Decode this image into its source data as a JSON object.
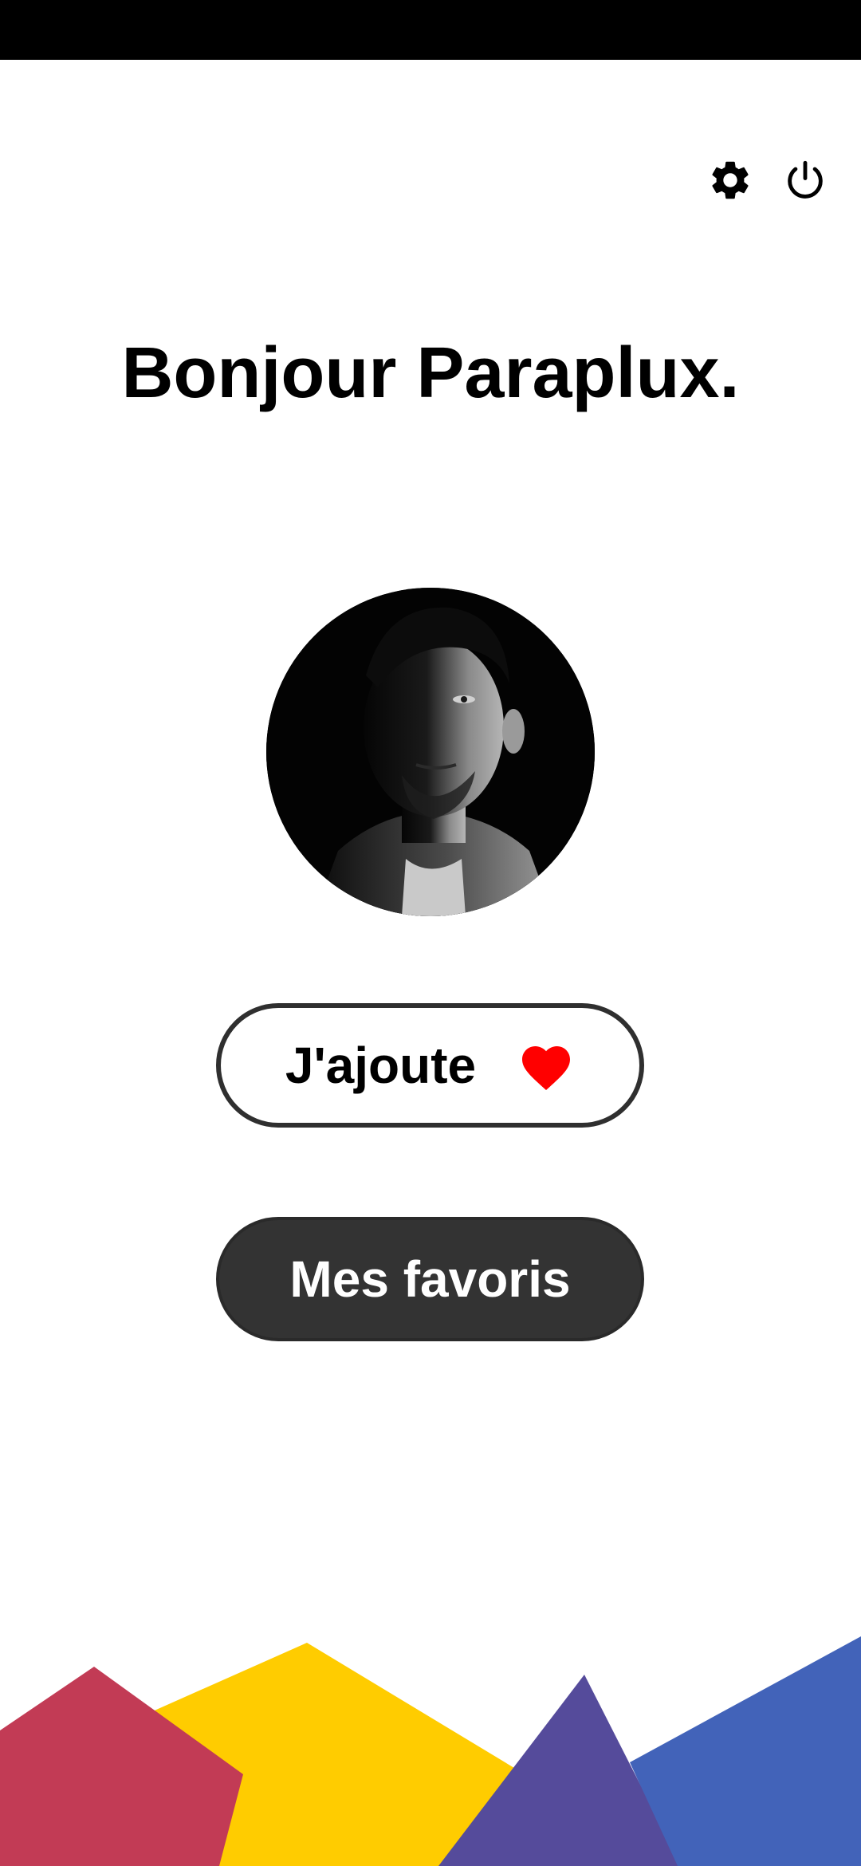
{
  "header": {
    "settings_icon": "gear-icon",
    "power_icon": "power-icon"
  },
  "greeting": {
    "text": "Bonjour Paraplux."
  },
  "profile": {
    "avatar_icon": "avatar"
  },
  "actions": {
    "add_label": "J'ajoute",
    "add_icon": "heart-icon",
    "favorites_label": "Mes favoris"
  },
  "colors": {
    "heart": "#ff0000",
    "button_dark": "#333333",
    "shape_red": "#c23b55",
    "shape_yellow": "#ffcc00",
    "shape_purple": "#554b9b",
    "shape_blue": "#4263b9"
  }
}
